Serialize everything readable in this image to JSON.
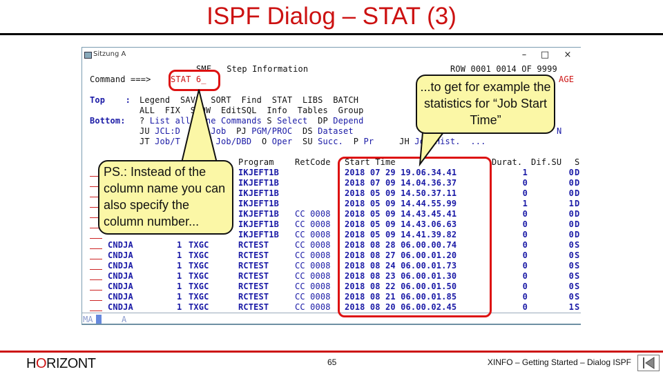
{
  "slide": {
    "title": "ISPF Dialog – STAT (3)",
    "footer": {
      "logo_prefix": "H",
      "logo_o": "O",
      "logo_suffix": "RIZONT",
      "page_number": "65",
      "caption": "XINFO – Getting Started – Dialog ISPF",
      "nav_icon": "first-page-icon"
    }
  },
  "terminal": {
    "window_title": "Sitzung A",
    "window_controls": {
      "minimize": "–",
      "maximize": "□",
      "close": "×"
    },
    "screen_title": "SMF   Step Information",
    "row_info": "ROW 0001 0014 OF 9999",
    "scroll_indicator": "AGE",
    "command_label": "Command ===>",
    "command_value": "STAT 6_",
    "top_label": "Top    :",
    "top_line_1": "Legend  SAVE  SORT  Find  STAT  LIBS  BATCH",
    "top_line_2": "ALL  FIX  SHOW  EditSQL  Info  Tables  Group",
    "bottom_label": "Bottom:",
    "bottom_line_1": [
      {
        "text": "? ",
        "color": "black"
      },
      {
        "text": "List all Line Commands ",
        "color": "blue"
      },
      {
        "text": "S ",
        "color": "black"
      },
      {
        "text": "Select  ",
        "color": "blue"
      },
      {
        "text": "DP ",
        "color": "black"
      },
      {
        "text": "Depend",
        "color": "blue"
      }
    ],
    "bottom_line_2": [
      {
        "text": "JU ",
        "color": "black"
      },
      {
        "text": "JCL:D    ",
        "color": "blue"
      },
      {
        "text": "J ",
        "color": "black"
      },
      {
        "text": "Job  ",
        "color": "blue"
      },
      {
        "text": "PJ ",
        "color": "black"
      },
      {
        "text": "PGM/PROC  ",
        "color": "blue"
      },
      {
        "text": "DS ",
        "color": "black"
      },
      {
        "text": "Dataset",
        "color": "blue"
      }
    ],
    "bottom_line_3": [
      {
        "text": "JT ",
        "color": "black"
      },
      {
        "text": "Job/T    ",
        "color": "blue"
      },
      {
        "text": "JB ",
        "color": "black"
      },
      {
        "text": "Job/DBD  ",
        "color": "blue"
      },
      {
        "text": "O ",
        "color": "black"
      },
      {
        "text": "Oper  ",
        "color": "blue"
      },
      {
        "text": "SU ",
        "color": "black"
      },
      {
        "text": "Succ.  ",
        "color": "blue"
      },
      {
        "text": "P ",
        "color": "black"
      },
      {
        "text": "Pr     ",
        "color": "blue"
      },
      {
        "text": "JH ",
        "color": "black"
      },
      {
        "text": "Job Hist.  ...",
        "color": "blue"
      }
    ],
    "bottom_line_2_tail": "N",
    "columns": {
      "program": "Program",
      "retcode": "RetCode",
      "start_time": "Start Time",
      "durat": "Durat.",
      "difsu": "Dif.SU",
      "s": "S"
    },
    "rows": [
      {
        "job": "",
        "step": "",
        "pgmx": "",
        "program": "IKJEFT1B",
        "retcode": "",
        "start": "2018 07 29 19.06.34.41",
        "durat": "1",
        "difsu": "0",
        "s": "D"
      },
      {
        "job": "",
        "step": "",
        "pgmx": "",
        "program": "IKJEFT1B",
        "retcode": "",
        "start": "2018 07 09 14.04.36.37",
        "durat": "0",
        "difsu": "0",
        "s": "D"
      },
      {
        "job": "",
        "step": "",
        "pgmx": "",
        "program": "IKJEFT1B",
        "retcode": "",
        "start": "2018 05 09 14.50.37.11",
        "durat": "0",
        "difsu": "0",
        "s": "D"
      },
      {
        "job": "",
        "step": "",
        "pgmx": "",
        "program": "IKJEFT1B",
        "retcode": "",
        "start": "2018 05 09 14.44.55.99",
        "durat": "1",
        "difsu": "1",
        "s": "D"
      },
      {
        "job": "",
        "step": "",
        "pgmx": "",
        "program": "IKJEFT1B",
        "retcode": "CC 0008",
        "start": "2018 05 09 14.43.45.41",
        "durat": "0",
        "difsu": "0",
        "s": "D"
      },
      {
        "job": "",
        "step": "",
        "pgmx": "",
        "program": "IKJEFT1B",
        "retcode": "CC 0008",
        "start": "2018 05 09 14.43.06.63",
        "durat": "0",
        "difsu": "0",
        "s": "D"
      },
      {
        "job": "",
        "step": "",
        "pgmx": "",
        "program": "IKJEFT1B",
        "retcode": "CC 0008",
        "start": "2018 05 09 14.41.39.82",
        "durat": "0",
        "difsu": "0",
        "s": "D"
      },
      {
        "job": "CNDJA",
        "step": "1",
        "pgmx": "TXGC",
        "program": "RCTEST",
        "retcode": "CC 0008",
        "start": "2018 08 28 06.00.00.74",
        "durat": "0",
        "difsu": "0",
        "s": "S"
      },
      {
        "job": "CNDJA",
        "step": "1",
        "pgmx": "TXGC",
        "program": "RCTEST",
        "retcode": "CC 0008",
        "start": "2018 08 27 06.00.01.20",
        "durat": "0",
        "difsu": "0",
        "s": "S"
      },
      {
        "job": "CNDJA",
        "step": "1",
        "pgmx": "TXGC",
        "program": "RCTEST",
        "retcode": "CC 0008",
        "start": "2018 08 24 06.00.01.73",
        "durat": "0",
        "difsu": "0",
        "s": "S"
      },
      {
        "job": "CNDJA",
        "step": "1",
        "pgmx": "TXGC",
        "program": "RCTEST",
        "retcode": "CC 0008",
        "start": "2018 08 23 06.00.01.30",
        "durat": "0",
        "difsu": "0",
        "s": "S"
      },
      {
        "job": "CNDJA",
        "step": "1",
        "pgmx": "TXGC",
        "program": "RCTEST",
        "retcode": "CC 0008",
        "start": "2018 08 22 06.00.01.50",
        "durat": "0",
        "difsu": "0",
        "s": "S"
      },
      {
        "job": "CNDJA",
        "step": "1",
        "pgmx": "TXGC",
        "program": "RCTEST",
        "retcode": "CC 0008",
        "start": "2018 08 21 06.00.01.85",
        "durat": "0",
        "difsu": "0",
        "s": "S"
      },
      {
        "job": "CNDJA",
        "step": "1",
        "pgmx": "TXGC",
        "program": "RCTEST",
        "retcode": "CC 0008",
        "start": "2018 08 20 06.00.02.45",
        "durat": "0",
        "difsu": "1",
        "s": "S"
      }
    ],
    "status_left": "MA",
    "status_mid": "A"
  },
  "callouts": {
    "right": "...to get for example the statistics for “Job Start Time”",
    "left": "PS.: Instead of the column name you can also specify the column number..."
  },
  "colors": {
    "title_red": "#cc1111",
    "terminal_blue": "#1a1aa6",
    "highlight_red": "#dd1111",
    "callout_fill": "#fbf7a6"
  }
}
